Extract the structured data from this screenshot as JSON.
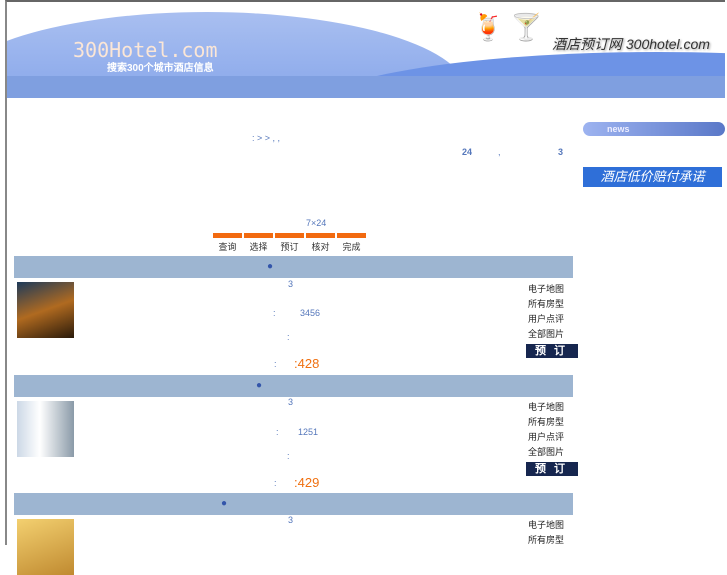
{
  "banner": {
    "logo": "300Hotel.com",
    "slogan": "搜索300个城市酒店信息",
    "site_title": "酒店预订网 300hotel.com"
  },
  "crumb": {
    "sep": ":  >  >    ,     ,",
    "hours": "24",
    "comma": ",",
    "count": "3",
    "service": "7×24"
  },
  "steps": [
    "查询",
    "选择",
    "预订",
    "核对",
    "完成"
  ],
  "sidebar": {
    "news": "news",
    "promise": "酒店低价赔付承诺"
  },
  "hotels": [
    {
      "stars": "3",
      "phone": "3456",
      "price": ":428",
      "links": [
        "电子地图",
        "所有房型",
        "用户点评",
        "全部图片"
      ],
      "book": "预订"
    },
    {
      "stars": "3",
      "phone": "1251",
      "price": ":429",
      "links": [
        "电子地图",
        "所有房型",
        "用户点评",
        "全部图片"
      ],
      "book": "预订"
    },
    {
      "stars": "3",
      "links": [
        "电子地图",
        "所有房型"
      ]
    }
  ]
}
